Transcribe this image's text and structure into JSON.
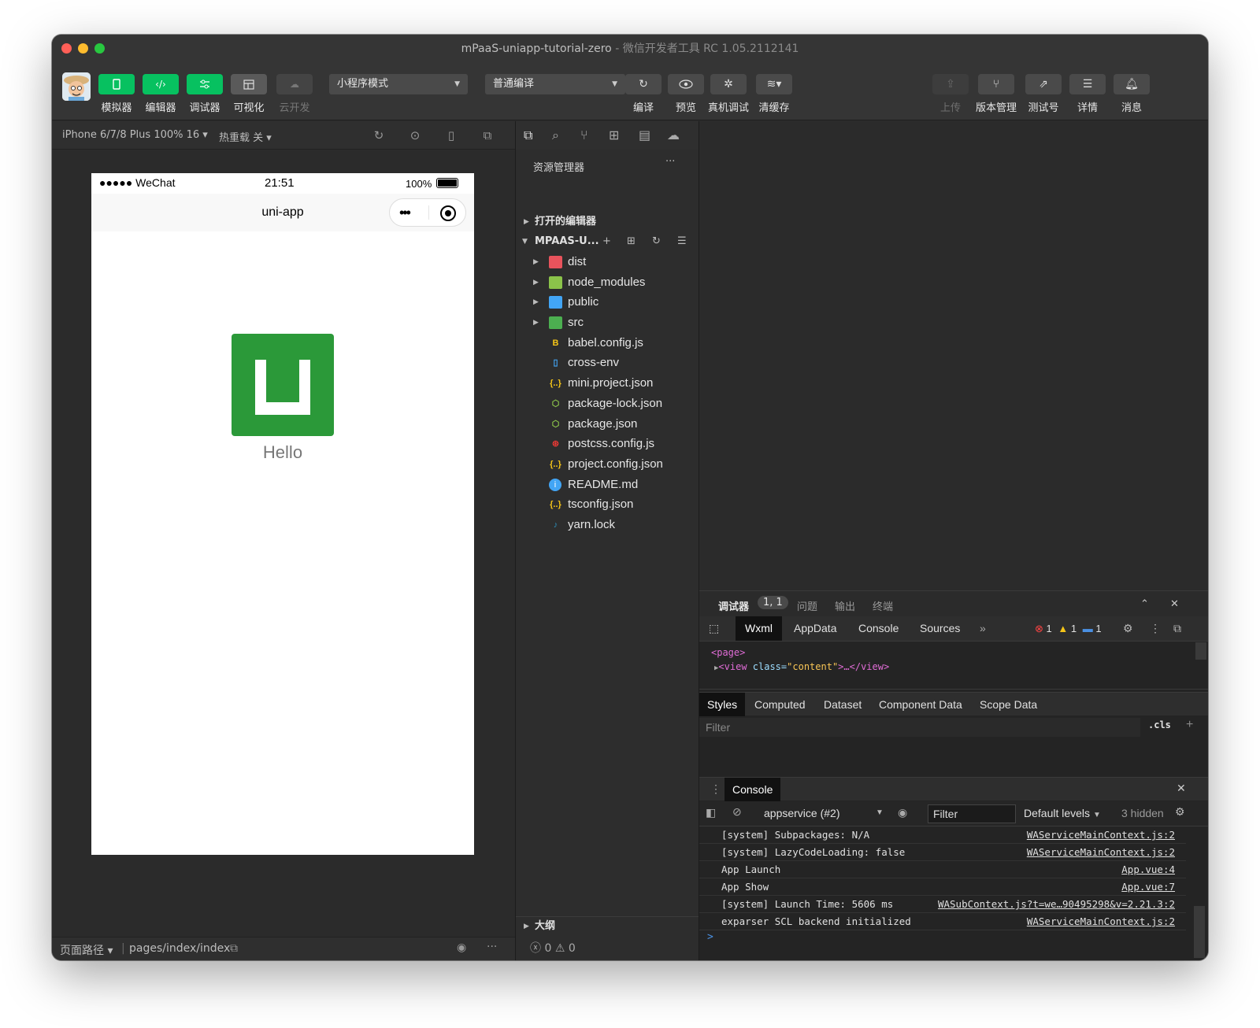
{
  "window": {
    "title": "mPaaS-uniapp-tutorial-zero",
    "title_suffix": " - 微信开发者工具 RC 1.05.2112141"
  },
  "toolbar": {
    "left_buttons": [
      {
        "label": "模拟器",
        "icon": "phone-icon"
      },
      {
        "label": "编辑器",
        "icon": "code-icon"
      },
      {
        "label": "调试器",
        "icon": "sliders-icon"
      },
      {
        "label": "可视化",
        "icon": "layout-icon"
      },
      {
        "label": "云开发",
        "icon": "cloud-icon"
      }
    ],
    "mode_select": "小程序模式",
    "compile_select": "普通编译",
    "mid_buttons": [
      {
        "label": "编译",
        "icon": "refresh-icon"
      },
      {
        "label": "预览",
        "icon": "eye-icon"
      },
      {
        "label": "真机调试",
        "icon": "bug-icon"
      },
      {
        "label": "清缓存",
        "icon": "layers-icon"
      }
    ],
    "right_buttons": [
      {
        "label": "上传",
        "icon": "upload-icon"
      },
      {
        "label": "版本管理",
        "icon": "branch-icon"
      },
      {
        "label": "测试号",
        "icon": "external-icon"
      },
      {
        "label": "详情",
        "icon": "menu-icon"
      },
      {
        "label": "消息",
        "icon": "bell-icon"
      }
    ]
  },
  "simulator": {
    "device": "iPhone 6/7/8 Plus 100% 16",
    "hot_reload": "热重载 关",
    "status_carrier": "●●●●● WeChat",
    "status_time": "21:51",
    "status_battery": "100%",
    "nav_title": "uni-app",
    "hello_text": "Hello",
    "footer_label": "页面路径",
    "footer_path": "pages/index/index"
  },
  "explorer": {
    "title": "资源管理器",
    "more": "···",
    "open_editors": "打开的编辑器",
    "project": "MPAAS-U...",
    "outline": "大纲",
    "status_errors": "0",
    "status_warnings": "0",
    "files": [
      {
        "name": "dist",
        "folder": true,
        "icon": "folder-dist-icon",
        "color": "#e8535c"
      },
      {
        "name": "node_modules",
        "folder": true,
        "icon": "folder-node-icon",
        "color": "#8bc34a"
      },
      {
        "name": "public",
        "folder": true,
        "icon": "folder-public-icon",
        "color": "#42a5f5"
      },
      {
        "name": "src",
        "folder": true,
        "icon": "folder-src-icon",
        "color": "#4caf50"
      },
      {
        "name": "babel.config.js",
        "folder": false,
        "icon": "babel-icon",
        "color": "#f5c518"
      },
      {
        "name": "cross-env",
        "folder": false,
        "icon": "file-icon",
        "color": "#42a5f5"
      },
      {
        "name": "mini.project.json",
        "folder": false,
        "icon": "json-icon",
        "color": "#f5c518"
      },
      {
        "name": "package-lock.json",
        "folder": false,
        "icon": "nodejs-icon",
        "color": "#8bc34a"
      },
      {
        "name": "package.json",
        "folder": false,
        "icon": "nodejs-icon",
        "color": "#8bc34a"
      },
      {
        "name": "postcss.config.js",
        "folder": false,
        "icon": "postcss-icon",
        "color": "#e53935"
      },
      {
        "name": "project.config.json",
        "folder": false,
        "icon": "json-icon",
        "color": "#f5c518"
      },
      {
        "name": "README.md",
        "folder": false,
        "icon": "info-icon",
        "color": "#42a5f5"
      },
      {
        "name": "tsconfig.json",
        "folder": false,
        "icon": "json-icon",
        "color": "#f5c518"
      },
      {
        "name": "yarn.lock",
        "folder": false,
        "icon": "yarn-icon",
        "color": "#2c8ebb"
      }
    ]
  },
  "debugger": {
    "tabs": [
      {
        "label": "调试器"
      },
      {
        "label": "问题"
      },
      {
        "label": "输出"
      },
      {
        "label": "终端"
      }
    ],
    "badge": "1, 1",
    "devtabs": [
      {
        "label": "Wxml"
      },
      {
        "label": "AppData"
      },
      {
        "label": "Console"
      },
      {
        "label": "Sources"
      }
    ],
    "error_count": "1",
    "warn_count": "1",
    "info_count": "1",
    "wxml_line1": "<page>",
    "wxml_line2_tag_open": "<view ",
    "wxml_line2_attr": "class=",
    "wxml_line2_val": "\"content\"",
    "wxml_line2_rest": ">…</view>",
    "style_tabs": [
      {
        "label": "Styles"
      },
      {
        "label": "Computed"
      },
      {
        "label": "Dataset"
      },
      {
        "label": "Component Data"
      },
      {
        "label": "Scope Data"
      }
    ],
    "filter_placeholder": "Filter",
    "cls": ".cls",
    "console_title": "Console",
    "context": "appservice (#2)",
    "console_filter": "Filter",
    "levels": "Default levels",
    "hidden": "3 hidden",
    "logs": [
      {
        "text": "[system] Subpackages: N/A",
        "src": "WAServiceMainContext.js:2"
      },
      {
        "text": "[system] LazyCodeLoading: false",
        "src": "WAServiceMainContext.js:2"
      },
      {
        "text": "App Launch",
        "src": "App.vue:4"
      },
      {
        "text": "App Show",
        "src": "App.vue:7"
      },
      {
        "text": "[system] Launch Time: 5606 ms",
        "src": "WASubContext.js?t=we…90495298&v=2.21.3:2"
      },
      {
        "text": "exparser SCL backend initialized",
        "src": "WAServiceMainContext.js:2"
      }
    ],
    "prompt": ">"
  },
  "colors": {
    "accent_green": "#07c160",
    "logo_green": "#2b9939"
  }
}
